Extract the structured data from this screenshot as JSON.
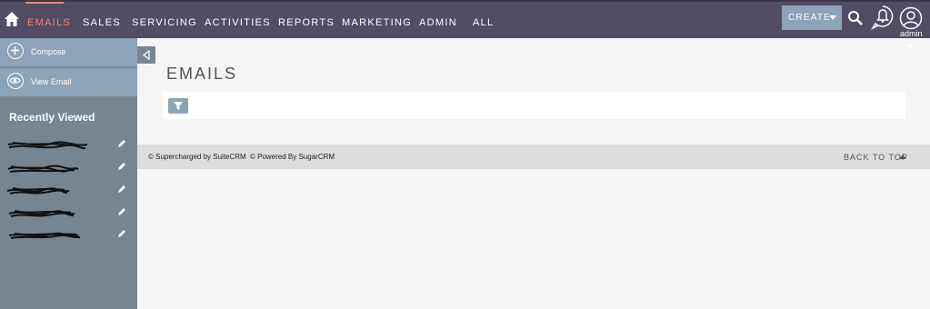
{
  "nav": {
    "items": [
      {
        "label": "EMAILS",
        "active": true
      },
      {
        "label": "SALES",
        "active": false
      },
      {
        "label": "SERVICING",
        "active": false
      },
      {
        "label": "ACTIVITIES",
        "active": false
      },
      {
        "label": "REPORTS",
        "active": false
      },
      {
        "label": "MARKETING",
        "active": false
      },
      {
        "label": "ADMIN",
        "active": false
      },
      {
        "label": "ALL",
        "active": false
      }
    ],
    "create_label": "CREATE",
    "user_label": "admin",
    "icons": [
      "home-icon",
      "search-icon",
      "bell-icon",
      "user-icon"
    ]
  },
  "sidebar": {
    "actions": [
      {
        "label": "Compose",
        "icon": "plus-circle-icon"
      },
      {
        "label": "View Email",
        "icon": "eye-icon"
      }
    ],
    "recently_viewed_title": "Recently Viewed",
    "recent_items_count": 5
  },
  "main": {
    "title": "EMAILS"
  },
  "footer": {
    "supercharged": "© Supercharged by SuiteCRM",
    "powered": "© Powered By SugarCRM",
    "back_to_top": "BACK TO TOP"
  },
  "colors": {
    "topbar": "#534d64",
    "accent": "#f08377",
    "sidebar": "#778591",
    "action": "#8da3b7",
    "footer": "#dcdcdc"
  }
}
